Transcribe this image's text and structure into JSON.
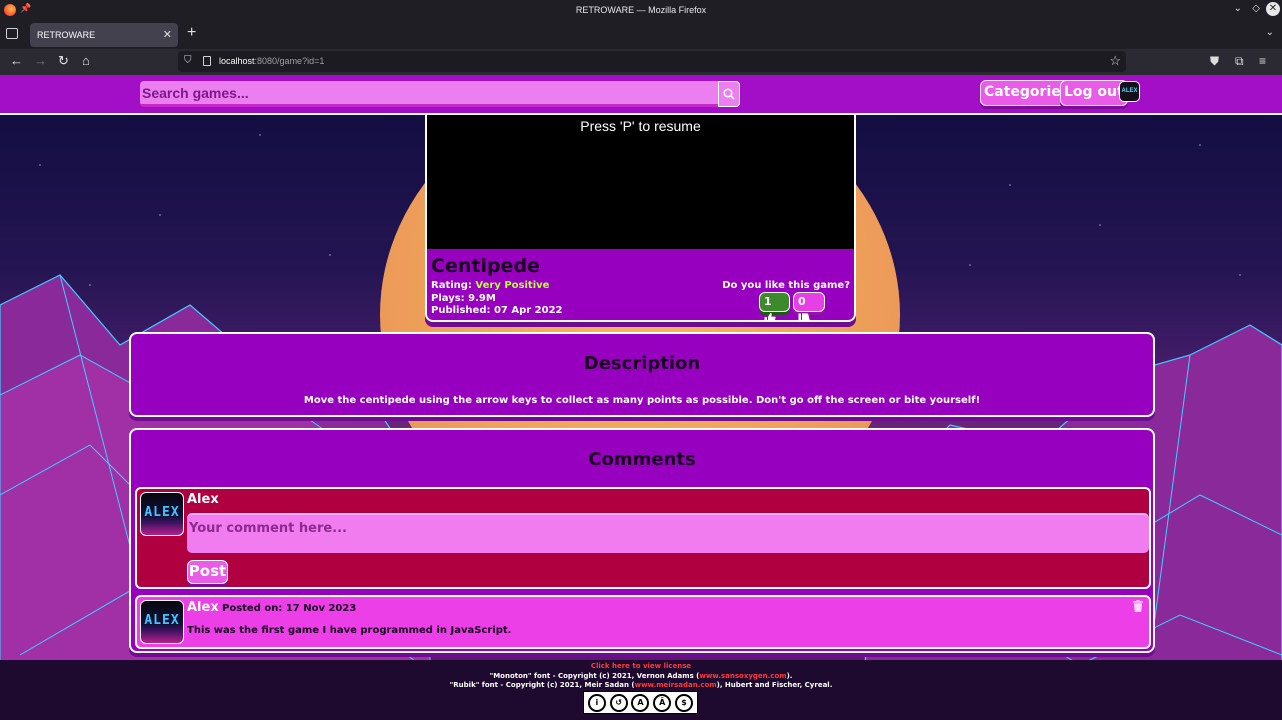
{
  "browser": {
    "window_title": "RETROWARE — Mozilla Firefox",
    "tab_title": "RETROWARE",
    "url_host": "localhost",
    "url_rest": ":8080/game?id=1"
  },
  "header": {
    "search_placeholder": "Search games...",
    "categories_label": "Categories",
    "logout_label": "Log out",
    "avatar_text": "ALEX"
  },
  "game": {
    "screen_text": "Press 'P' to resume",
    "title": "Centipede",
    "rating_label": "Rating:",
    "rating_value": "Very Positive",
    "plays": "Plays: 9.9M",
    "published": "Published: 07 Apr 2022",
    "like_question": "Do you like this game?",
    "likes": "1",
    "dislikes": "0"
  },
  "description": {
    "heading": "Description",
    "text": "Move the centipede using the arrow keys to collect as many points as possible. Don't go off the screen or bite yourself!"
  },
  "comments": {
    "heading": "Comments",
    "form": {
      "author": "Alex",
      "avatar_text": "ALEX",
      "placeholder": "Your comment here...",
      "post_label": "Post"
    },
    "items": [
      {
        "author": "Alex",
        "avatar_text": "ALEX",
        "posted": "Posted on: 17 Nov 2023",
        "body": "This was the first game I have programmed in JavaScript."
      }
    ]
  },
  "footer": {
    "license_link": "Click here to view license",
    "monoton_pre": "\"Monoton\" font - Copyright (c) 2021, Vernon Adams (",
    "monoton_link": "www.sansoxygen.com",
    "monoton_post": ").",
    "rubik_pre": "\"Rubik\" font - Copyright (c) 2021, Meir Sadan (",
    "rubik_link": "www.meirsadan.com",
    "rubik_post": "), Hubert and Fischer, Cyreal."
  },
  "colors": {
    "header_bg": "#a30fc7",
    "panel_bg": "#9800bf",
    "comment_form_bg": "#b0003f",
    "comment_item_bg": "#ec3fe8",
    "rating_positive": "#b7ff3f",
    "like_bg": "#3d8a2c"
  },
  "icons": {
    "search": "magnifier-icon",
    "like": "thumbs-up-icon",
    "dislike": "thumbs-down-icon",
    "delete": "trash-icon"
  }
}
